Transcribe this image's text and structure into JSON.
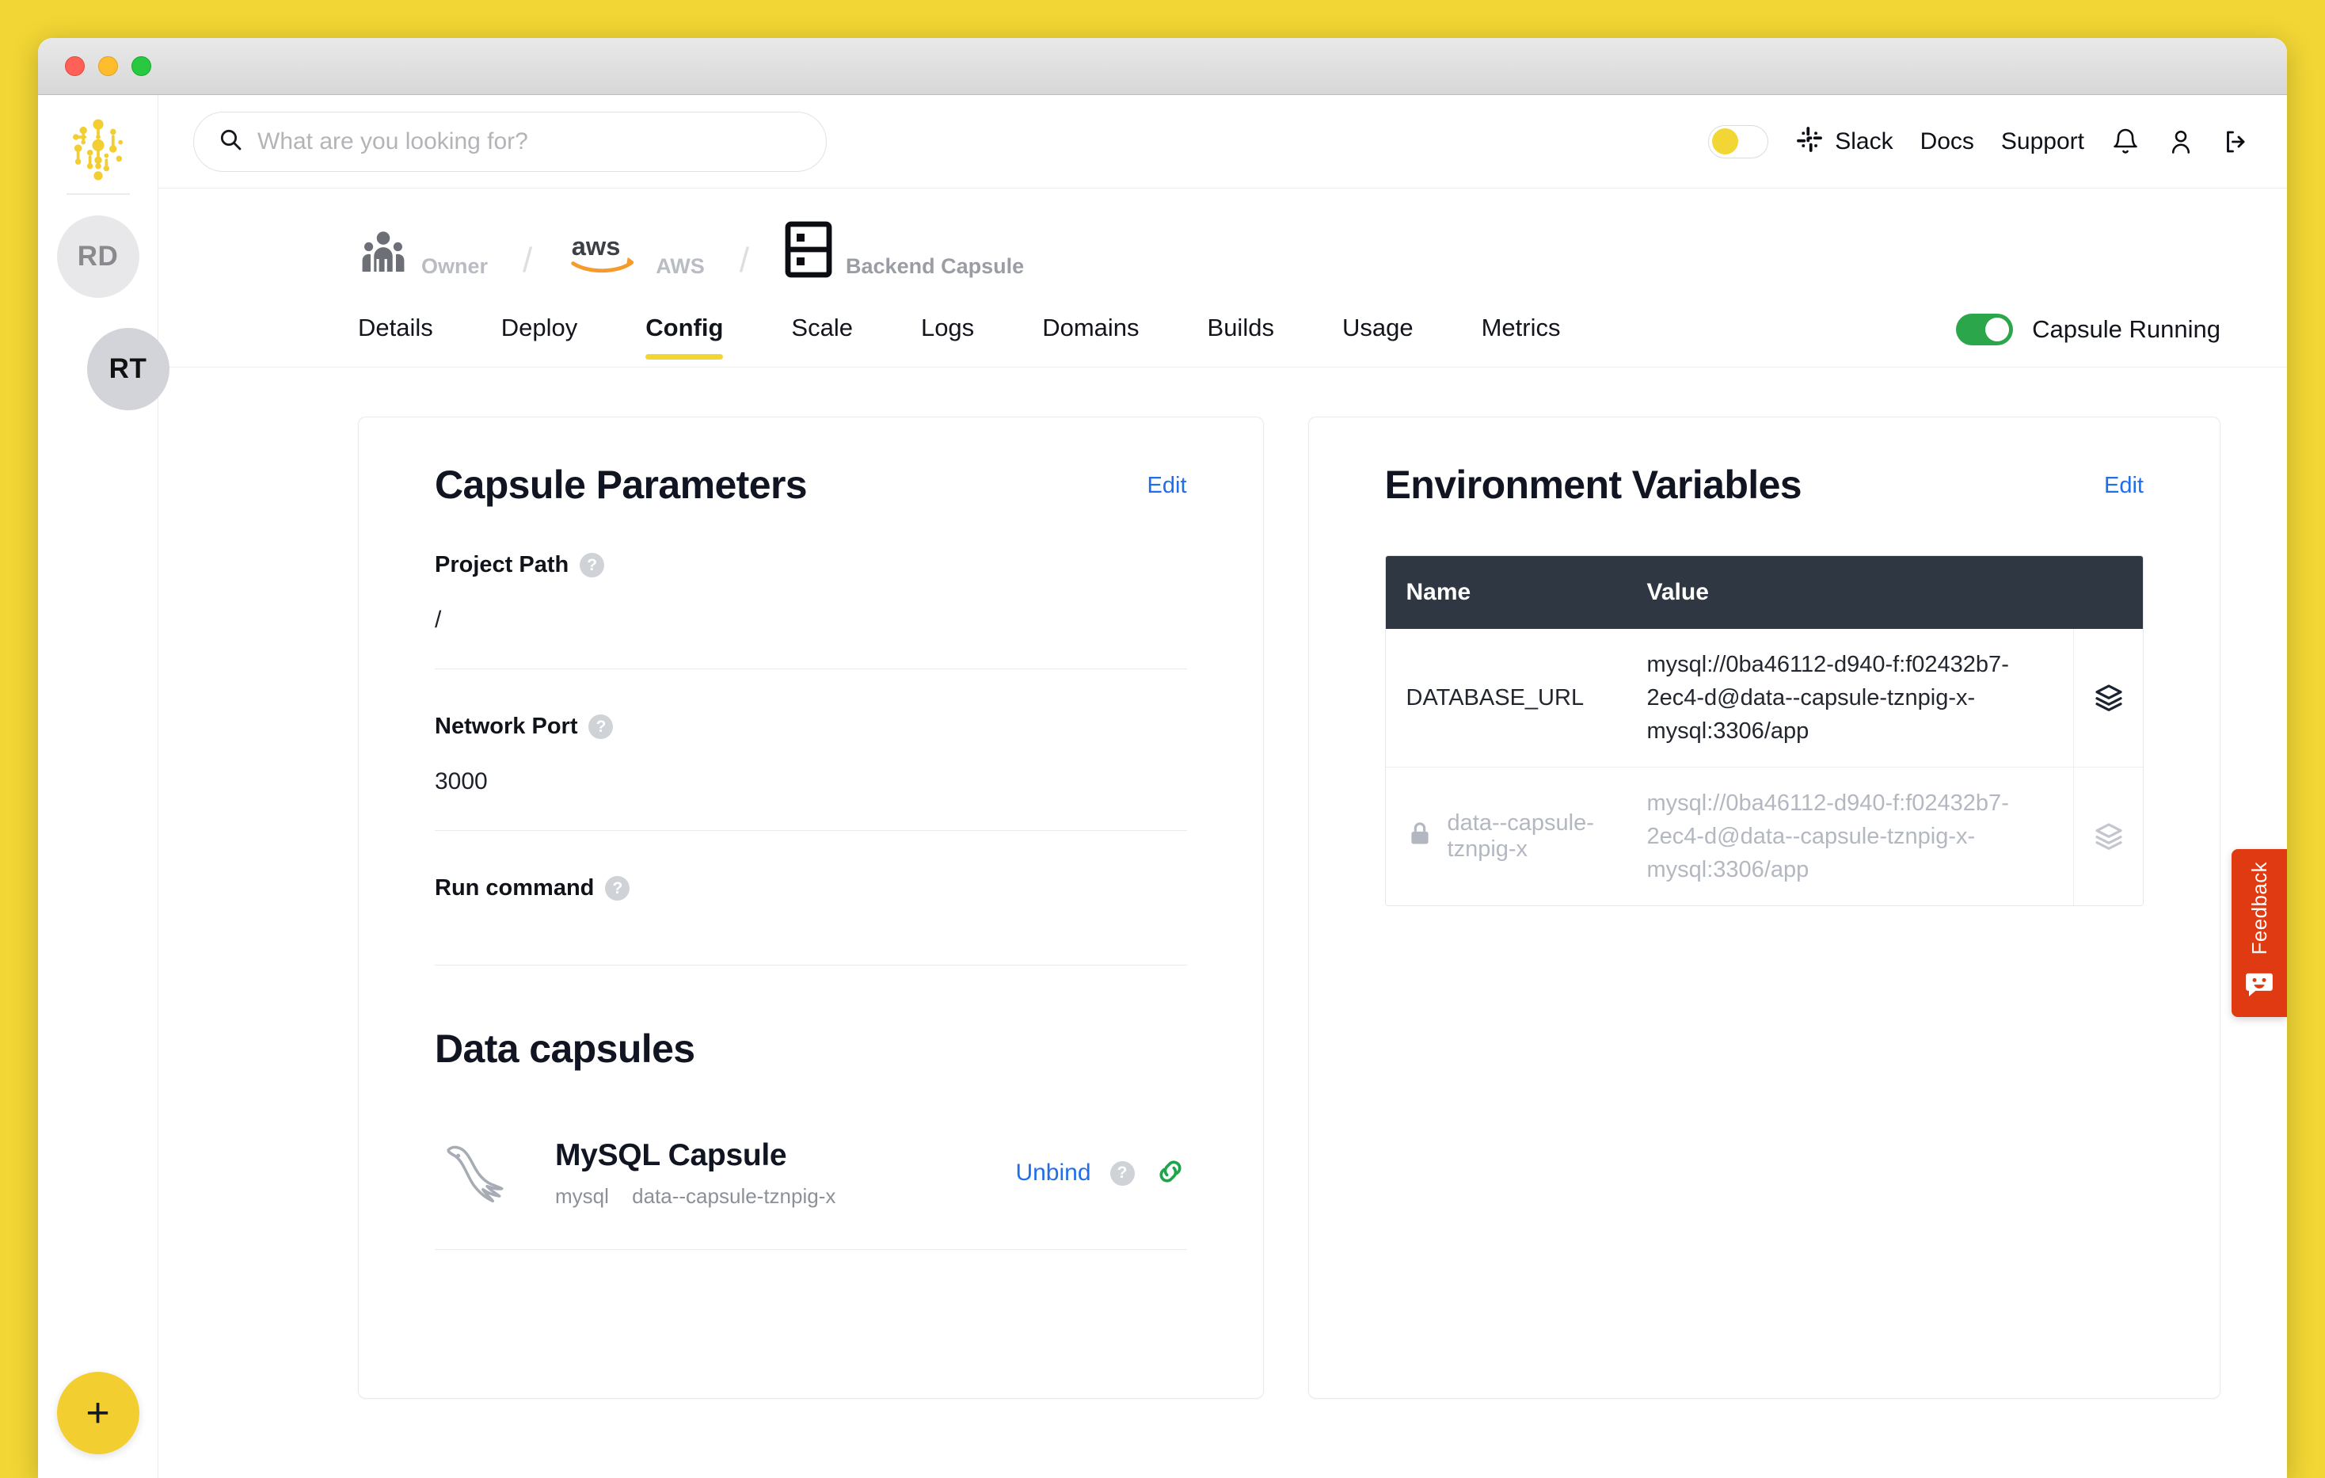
{
  "window": {
    "traffic_lights": [
      "close",
      "minimize",
      "zoom"
    ]
  },
  "sidebar": {
    "logo_name": "capsule-logo",
    "avatars": [
      {
        "initials": "RD",
        "active": false
      },
      {
        "initials": "RT",
        "active": true
      }
    ],
    "add_button_label": "+"
  },
  "topbar": {
    "search": {
      "value": "",
      "placeholder": "What are you looking for?"
    },
    "theme_toggle": {
      "state": "off",
      "knob_color": "#F2D635"
    },
    "links": [
      {
        "label": "Slack",
        "icon": "slack-icon"
      },
      {
        "label": "Docs",
        "icon": null
      },
      {
        "label": "Support",
        "icon": null
      }
    ],
    "icons": [
      "bell-icon",
      "user-icon",
      "logout-icon"
    ]
  },
  "breadcrumb": [
    {
      "label": "Owner",
      "icon": "team-icon"
    },
    {
      "label": "AWS",
      "icon": "aws-icon"
    },
    {
      "label": "Backend Capsule",
      "icon": "capsule-icon"
    }
  ],
  "tabs": [
    {
      "label": "Details",
      "active": false
    },
    {
      "label": "Deploy",
      "active": false
    },
    {
      "label": "Config",
      "active": true
    },
    {
      "label": "Scale",
      "active": false
    },
    {
      "label": "Logs",
      "active": false
    },
    {
      "label": "Domains",
      "active": false
    },
    {
      "label": "Builds",
      "active": false
    },
    {
      "label": "Usage",
      "active": false
    },
    {
      "label": "Metrics",
      "active": false
    }
  ],
  "run_state": {
    "label": "Capsule Running",
    "enabled": true,
    "color": "#2BA64A"
  },
  "capsule_parameters": {
    "title": "Capsule Parameters",
    "edit_label": "Edit",
    "fields": [
      {
        "label": "Project Path",
        "value": "/",
        "help": "?"
      },
      {
        "label": "Network Port",
        "value": "3000",
        "help": "?"
      },
      {
        "label": "Run command",
        "value": "",
        "help": "?"
      }
    ]
  },
  "data_capsules": {
    "title": "Data capsules",
    "items": [
      {
        "name": "MySQL Capsule",
        "engine": "mysql",
        "identifier": "data--capsule-tznpig-x",
        "action_label": "Unbind",
        "help": "?",
        "link_icon": "link-icon",
        "logo": "mysql-dolphin-icon"
      }
    ]
  },
  "environment_variables": {
    "title": "Environment Variables",
    "edit_label": "Edit",
    "columns": [
      "Name",
      "Value"
    ],
    "rows": [
      {
        "name": "DATABASE_URL",
        "value": "mysql://0ba46112-d940-f:f02432b7-2ec4-d@data--capsule-tznpig-x-mysql:3306/app",
        "locked": false,
        "action_icon": "layers-icon"
      },
      {
        "name": "data--capsule-tznpig-x",
        "value": "mysql://0ba46112-d940-f:f02432b7-2ec4-d@data--capsule-tznpig-x-mysql:3306/app",
        "locked": true,
        "action_icon": "layers-icon"
      }
    ]
  },
  "feedback": {
    "label": "Feedback",
    "icon": "smiley-chat-icon",
    "color": "#E03A12"
  },
  "colors": {
    "page_background": "#F2D635",
    "accent": "#F2D635",
    "link": "#1F6FEB",
    "running": "#2BA64A",
    "table_header": "#2F3742"
  }
}
